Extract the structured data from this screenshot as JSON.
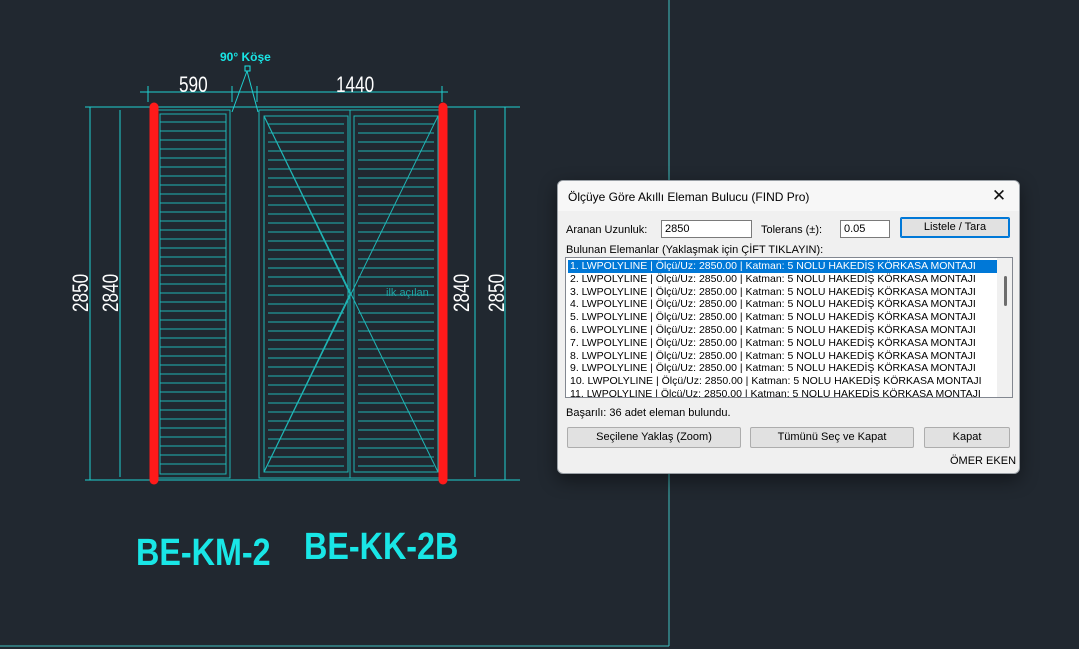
{
  "drawing": {
    "corner_label": "90° Köşe",
    "dim_left_width": "590",
    "dim_right_width": "1440",
    "dim_outer_height": "2850",
    "dim_inner_height": "2840",
    "faint_text": "ilk açılan",
    "label_left": "BE-KM-2",
    "label_right": "BE-KK-2B",
    "colors": {
      "background": "#212830",
      "cyan": "#19e6e6",
      "highlight": "#ff1a1a",
      "frame": "#1fb5b5"
    }
  },
  "dialog": {
    "title": "Ölçüye Göre Akıllı Eleman Bulucu (FIND Pro)",
    "close_icon": "close-icon",
    "search_label": "Aranan Uzunluk:",
    "search_value": "2850",
    "tolerance_label": "Tolerans (±):",
    "tolerance_value": "0.05",
    "list_button": "Listele / Tara",
    "found_label": "Bulunan Elemanlar (Yaklaşmak için ÇİFT TIKLAYIN):",
    "results": [
      "1. LWPOLYLINE | Ölçü/Uz: 2850.00 | Katman: 5 NOLU HAKEDİŞ KÖRKASA MONTAJI",
      "2. LWPOLYLINE | Ölçü/Uz: 2850.00 | Katman: 5 NOLU HAKEDİŞ KÖRKASA MONTAJI",
      "3. LWPOLYLINE | Ölçü/Uz: 2850.00 | Katman: 5 NOLU HAKEDİŞ KÖRKASA MONTAJI",
      "4. LWPOLYLINE | Ölçü/Uz: 2850.00 | Katman: 5 NOLU HAKEDİŞ KÖRKASA MONTAJI",
      "5. LWPOLYLINE | Ölçü/Uz: 2850.00 | Katman: 5 NOLU HAKEDİŞ KÖRKASA MONTAJI",
      "6. LWPOLYLINE | Ölçü/Uz: 2850.00 | Katman: 5 NOLU HAKEDİŞ KÖRKASA MONTAJI",
      "7. LWPOLYLINE | Ölçü/Uz: 2850.00 | Katman: 5 NOLU HAKEDİŞ KÖRKASA MONTAJI",
      "8. LWPOLYLINE | Ölçü/Uz: 2850.00 | Katman: 5 NOLU HAKEDİŞ KÖRKASA MONTAJI",
      "9. LWPOLYLINE | Ölçü/Uz: 2850.00 | Katman: 5 NOLU HAKEDİŞ KÖRKASA MONTAJI",
      "10. LWPOLYLINE | Ölçü/Uz: 2850.00 | Katman: 5 NOLU HAKEDİŞ KÖRKASA MONTAJI",
      "11. LWPOLYLINE | Ölçü/Uz: 2850.00 | Katman: 5 NOLU HAKEDİŞ KÖRKASA MONTAJI"
    ],
    "status": "Başarılı: 36 adet eleman bulundu.",
    "zoom_button": "Seçilene Yaklaş (Zoom)",
    "select_all_button": "Tümünü Seç ve Kapat",
    "close_button": "Kapat",
    "author": "ÖMER EKEN"
  }
}
